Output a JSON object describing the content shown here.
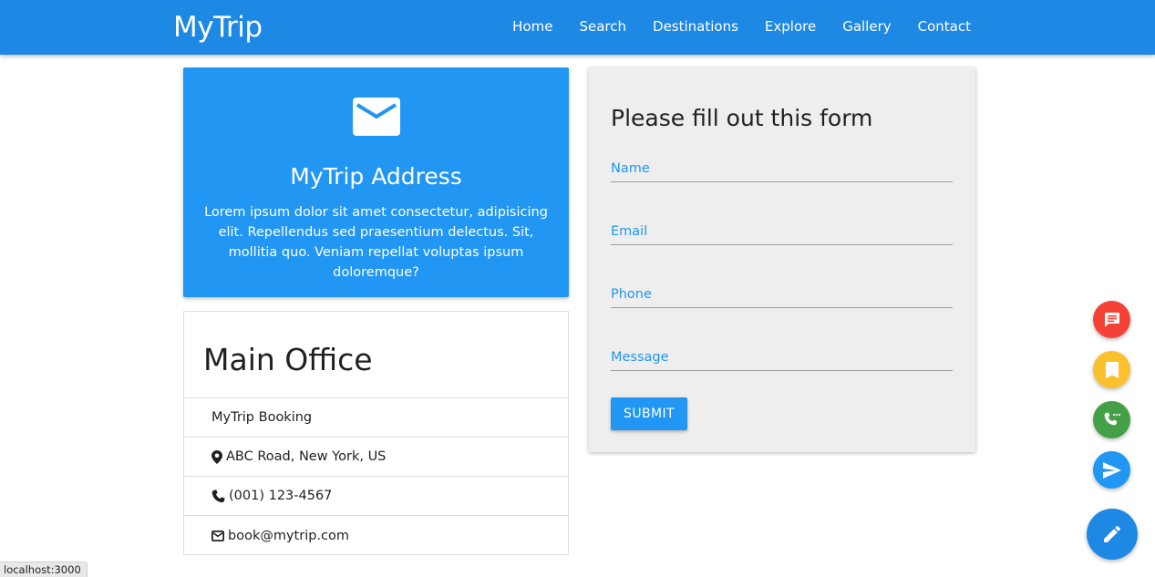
{
  "navbar": {
    "brand": "MyTrip",
    "links": [
      "Home",
      "Search",
      "Destinations",
      "Explore",
      "Gallery",
      "Contact"
    ]
  },
  "address_card": {
    "icon": "mail-icon",
    "title": "MyTrip Address",
    "text": "Lorem ipsum dolor sit amet consectetur, adipisicing elit. Repellendus sed praesentium delectus. Sit, mollitia quo. Veniam repellat voluptas ipsum doloremque?"
  },
  "office": {
    "title": "Main Office",
    "company": "MyTrip Booking",
    "address": "ABC Road, New York, US",
    "phone": "(001) 123-4567",
    "email": "book@mytrip.com"
  },
  "form": {
    "title": "Please fill out this form",
    "name_placeholder": "Name",
    "email_placeholder": "Email",
    "phone_placeholder": "Phone",
    "message_placeholder": "Message",
    "submit_label": "SUBMIT"
  },
  "fabs": [
    {
      "icon": "chat-icon",
      "color": "#f44336"
    },
    {
      "icon": "bookmark-icon",
      "color": "#fbc02d"
    },
    {
      "icon": "phone-dial-icon",
      "color": "#43a047"
    },
    {
      "icon": "send-icon",
      "color": "#2196f3"
    },
    {
      "icon": "edit-icon",
      "color": "#1e88e5"
    }
  ],
  "colors": {
    "primary": "#1e88e5",
    "card_blue": "#2196f3",
    "form_bg": "#eeeeee"
  },
  "status_bar": {
    "url": "localhost:3000"
  }
}
